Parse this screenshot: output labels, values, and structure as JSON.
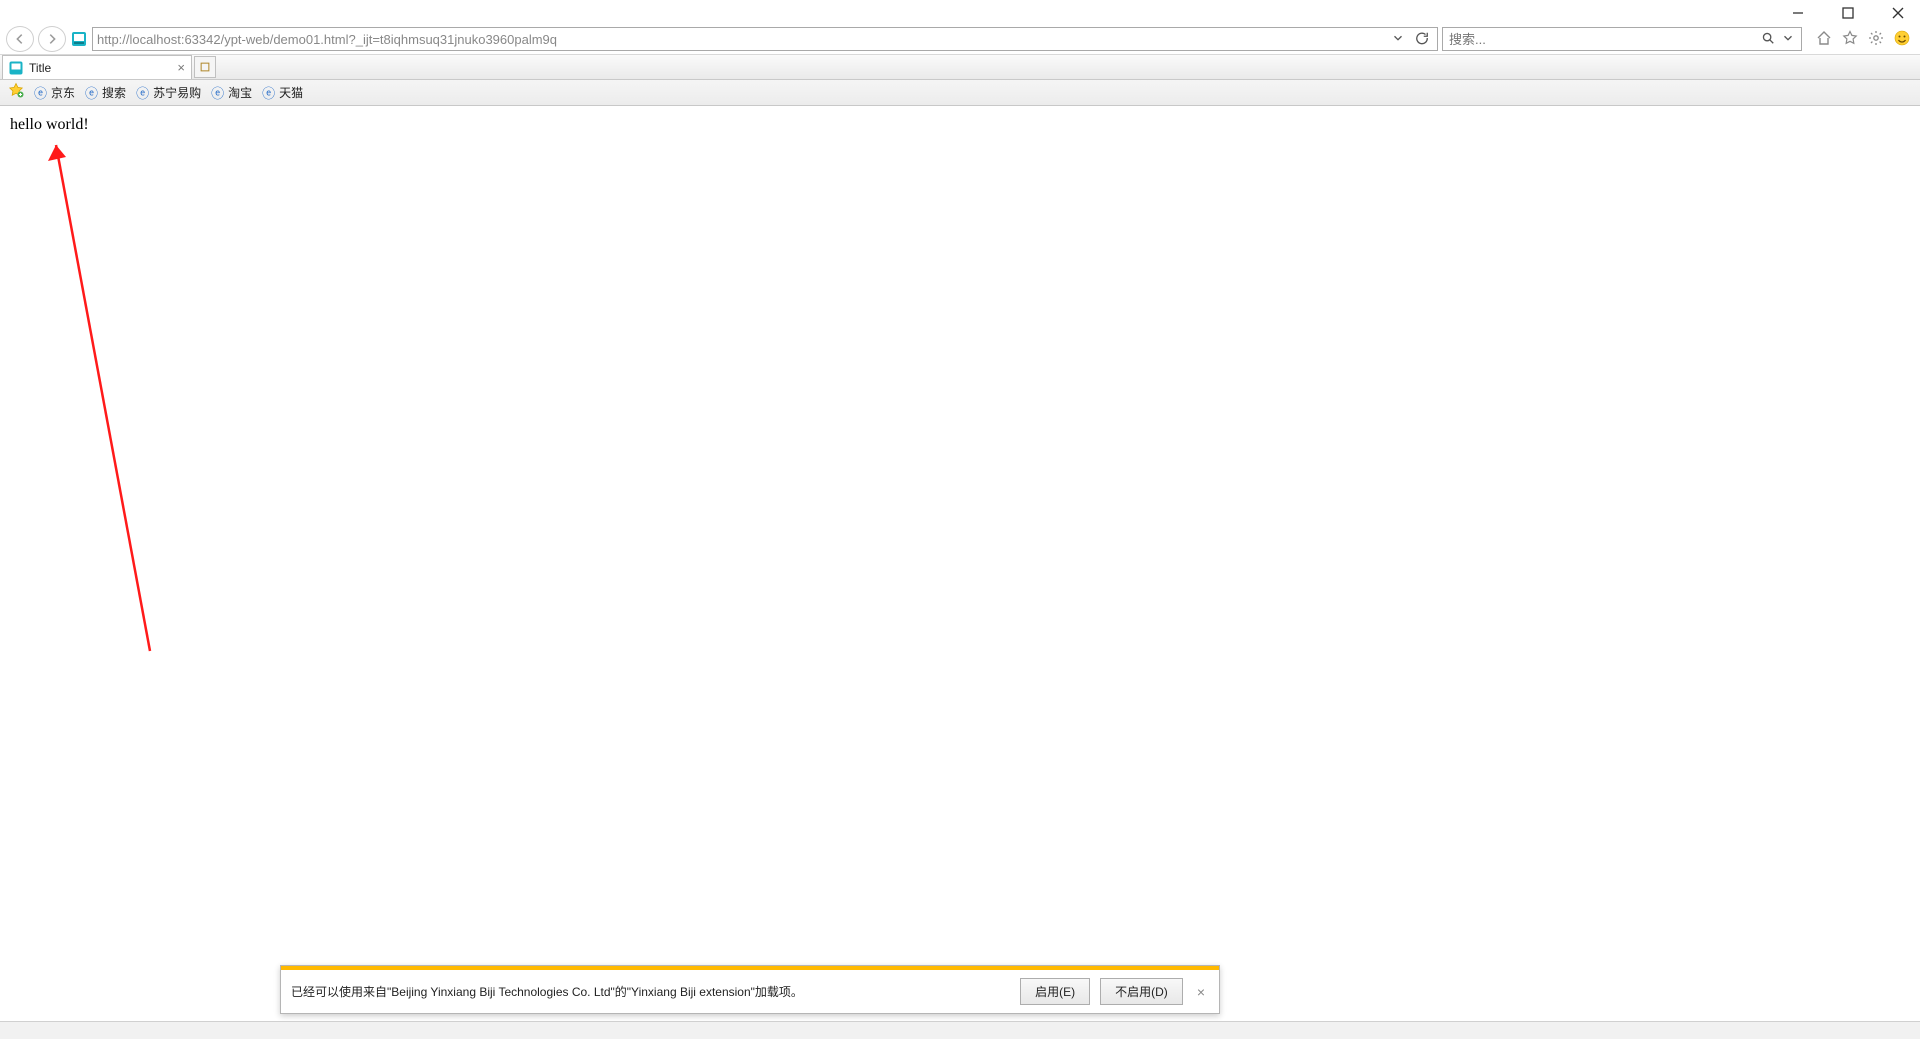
{
  "titlebar": {},
  "toolbar": {
    "url_prefix": "http://",
    "url_host": "localhost",
    "url_rest": ":63342/ypt-web/demo01.html?_ijt=t8iqhmsuq31jnuko3960palm9q",
    "url_full": "http://localhost:63342/ypt-web/demo01.html?_ijt=t8iqhmsuq31jnuko3960palm9q",
    "search_placeholder": "搜索..."
  },
  "tab": {
    "title": "Title"
  },
  "bookmarks": {
    "items": [
      "京东",
      "搜索",
      "苏宁易购",
      "淘宝",
      "天猫"
    ]
  },
  "page": {
    "body_text": "hello world!"
  },
  "notification": {
    "text": "已经可以使用来自\"Beijing Yinxiang Biji Technologies Co. Ltd\"的\"Yinxiang Biji extension\"加载项。",
    "enable_label": "启用(E)",
    "disable_label": "不启用(D)"
  }
}
